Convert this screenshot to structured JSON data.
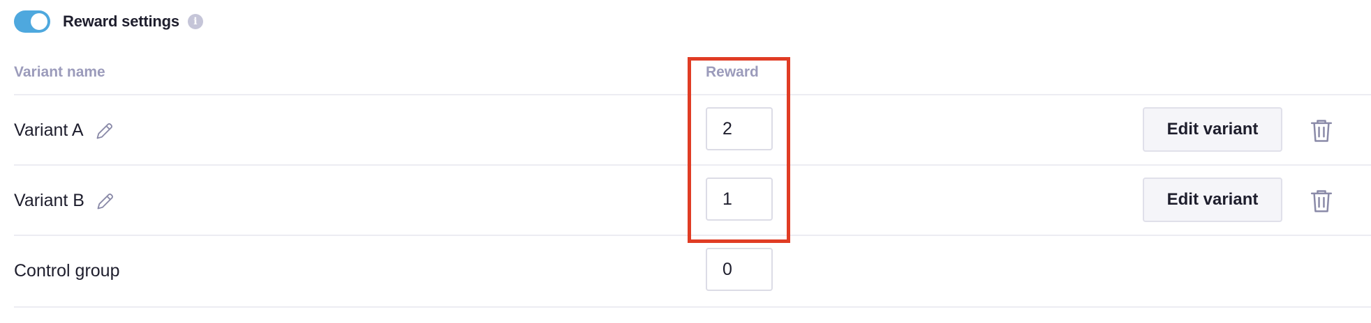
{
  "header": {
    "toggle_on": true,
    "title": "Reward settings",
    "info_glyph": "i"
  },
  "table": {
    "columns": {
      "name": "Variant name",
      "reward": "Reward"
    },
    "rows": [
      {
        "name": "Variant A",
        "reward": "2",
        "editable": true,
        "edit_label": "Edit variant"
      },
      {
        "name": "Variant B",
        "reward": "1",
        "editable": true,
        "edit_label": "Edit variant"
      },
      {
        "name": "Control group",
        "reward": "0",
        "editable": false
      }
    ]
  },
  "colors": {
    "toggle": "#4ea8de",
    "highlight": "#e03c24",
    "header_text": "#9b9bbb"
  }
}
